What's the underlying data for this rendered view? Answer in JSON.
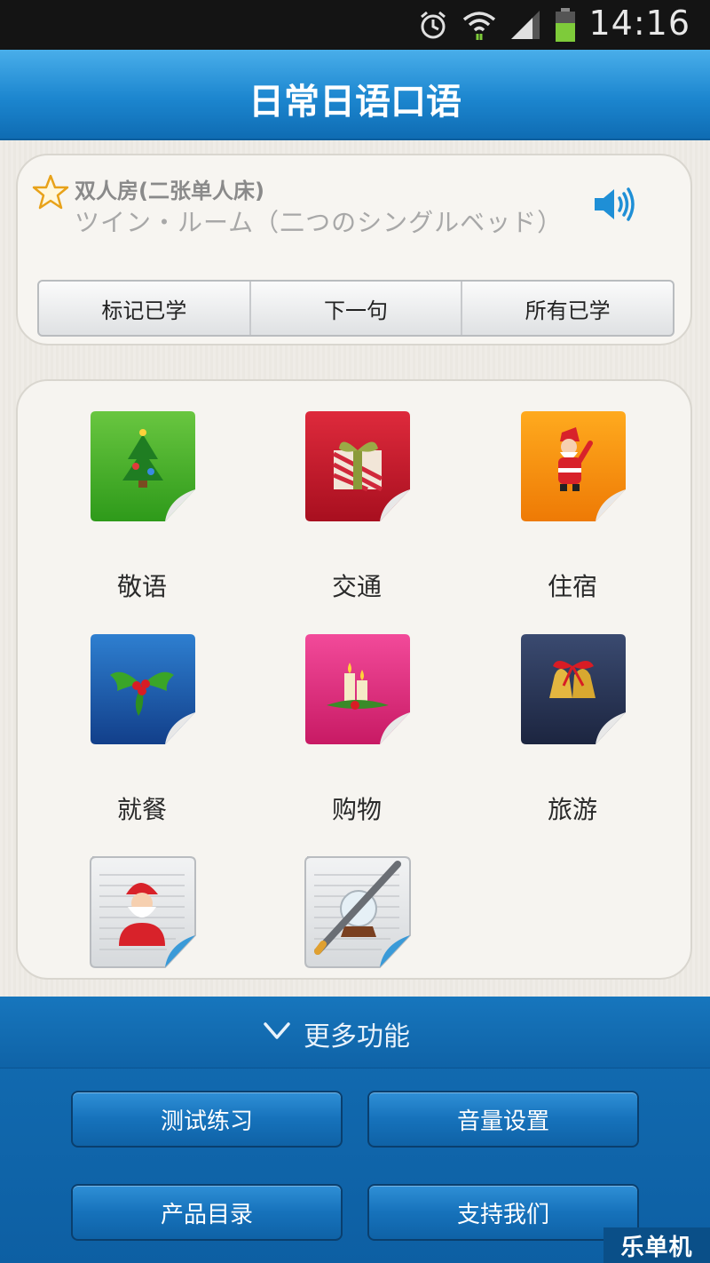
{
  "status_bar": {
    "time": "14:16",
    "icons": [
      "alarm-icon",
      "wifi-icon",
      "signal-icon",
      "battery-icon"
    ]
  },
  "header": {
    "title": "日常日语口语"
  },
  "phrase": {
    "chinese": "双人房(二张单人床)",
    "japanese": "ツイン・ルーム（二つのシングルベッド）",
    "actions": [
      "标记已学",
      "下一句",
      "所有已学"
    ]
  },
  "categories": [
    {
      "label": "敬语",
      "icon": "christmas-tree-icon",
      "color": "#3aa520"
    },
    {
      "label": "交通",
      "icon": "gift-box-icon",
      "color": "#c0162a"
    },
    {
      "label": "住宿",
      "icon": "santa-claus-icon",
      "color": "#f08a08"
    },
    {
      "label": "就餐",
      "icon": "holly-icon",
      "color": "#1a5fb0"
    },
    {
      "label": "购物",
      "icon": "candles-icon",
      "color": "#e2307f"
    },
    {
      "label": "旅游",
      "icon": "bells-icon",
      "color": "#2a3553"
    },
    {
      "label": "",
      "icon": "santa-notepad-icon",
      "color": "#e4e6e8"
    },
    {
      "label": "",
      "icon": "snowglobe-pen-notepad-icon",
      "color": "#e4e6e8"
    }
  ],
  "bottom": {
    "more_label": "更多功能",
    "buttons": [
      "测试练习",
      "音量设置",
      "产品目录",
      "支持我们"
    ]
  },
  "watermark": "乐单机"
}
